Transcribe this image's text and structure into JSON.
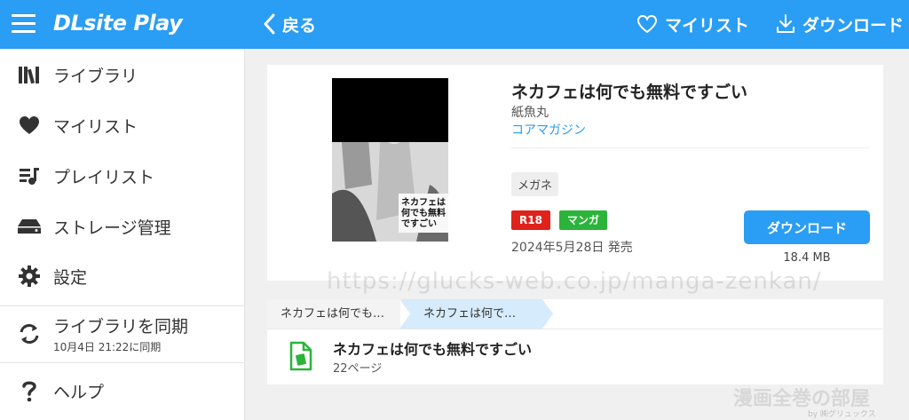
{
  "app": {
    "logo": "DLsite Play"
  },
  "topbar": {
    "back_label": "戻る",
    "mylist_label": "マイリスト",
    "download_label": "ダウンロード"
  },
  "sidebar": {
    "items": [
      {
        "label": "ライブラリ",
        "icon": "library-icon"
      },
      {
        "label": "マイリスト",
        "icon": "heart-icon"
      },
      {
        "label": "プレイリスト",
        "icon": "playlist-icon"
      },
      {
        "label": "ストレージ管理",
        "icon": "storage-icon"
      },
      {
        "label": "設定",
        "icon": "gear-icon"
      }
    ],
    "sync": {
      "label": "ライブラリを同期",
      "sub": "10月4日 21:22に同期",
      "icon": "sync-icon"
    },
    "help": {
      "label": "ヘルプ",
      "icon": "question-icon"
    }
  },
  "work": {
    "title": "ネカフェは何でも無料ですごい",
    "author": "紙魚丸",
    "circle": "コアマガジン",
    "tag": "メガネ",
    "badges": {
      "r18": "R18",
      "manga": "マンガ"
    },
    "date": "2024年5月28日 発売",
    "download_label": "ダウンロード",
    "size": "18.4 MB",
    "cover_text": "ネカフェは何でも無料ですごい 紙魚丸"
  },
  "breadcrumb": {
    "first": "ネカフェは何でも…",
    "second": "ネカフェは何で…"
  },
  "chapter": {
    "title": "ネカフェは何でも無料ですごい",
    "pages": "22ページ"
  },
  "watermark": "https://glucks-web.co.jp/manga-zenkan/",
  "corner_watermark": {
    "main": "漫画全巻の部屋",
    "sub": "by ㈱グリュックス"
  },
  "colors": {
    "accent": "#2a9df4",
    "r18": "#e0221c",
    "manga": "#2bb43a"
  }
}
